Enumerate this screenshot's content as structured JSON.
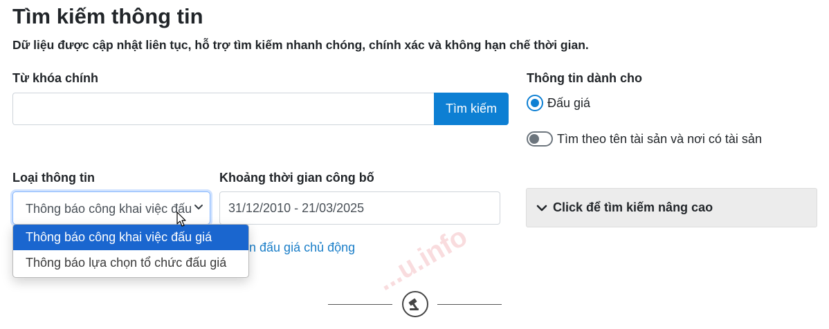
{
  "header": {
    "title": "Tìm kiếm thông tin",
    "subtitle": "Dữ liệu được cập nhật liên tục, hỗ trợ tìm kiếm nhanh chóng, chính xác và không hạn chế thời gian."
  },
  "keyword": {
    "label": "Từ khóa chính",
    "value": "",
    "button_label": "Tìm kiếm"
  },
  "audience": {
    "label": "Thông tin dành cho",
    "radio_label": "Đấu giá",
    "toggle_label": "Tìm theo tên tài sản và nơi có tài sản"
  },
  "info_type": {
    "label": "Loại thông tin",
    "selected": "Thông báo công khai việc đấu giá",
    "options": [
      "Thông báo công khai việc đấu giá",
      "Thông báo lựa chọn tổ chức đấu giá"
    ]
  },
  "period": {
    "label": "Khoảng thời gian công bố",
    "value": "31/12/2010 - 21/03/2025"
  },
  "advanced": {
    "label": "Click để tìm kiếm nâng cao"
  },
  "link": {
    "partial_text": "ản đấu giá chủ động"
  },
  "watermark": "...u.info",
  "colors": {
    "accent": "#0d7fd3",
    "selected_option": "#1a66cf",
    "link": "#1a7ec8"
  }
}
